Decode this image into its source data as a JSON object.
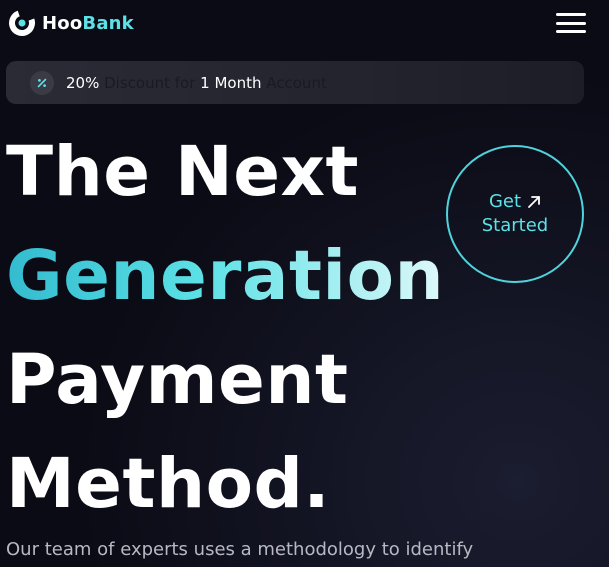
{
  "header": {
    "logo_main": "Hoo",
    "logo_accent": "Bank",
    "menu_icon": "hamburger-menu-icon"
  },
  "promo": {
    "icon": "discount-icon",
    "percent": "20%",
    "text1": "Discount for",
    "duration": "1 Month",
    "text2": "Account"
  },
  "hero": {
    "line1": "The Next",
    "line2": "Generation",
    "line3": "Payment",
    "line4": "Method.",
    "cta_line1": "Get",
    "cta_line2": "Started",
    "cta_icon": "arrow-up-right-icon",
    "subtitle": "Our team of experts uses a methodology to identify"
  },
  "colors": {
    "background": "#0b0b15",
    "accent": "#5ce1e6",
    "text": "#ffffff",
    "promo_bg": "#2b2b35",
    "subtitle": "#b8b8c4"
  }
}
